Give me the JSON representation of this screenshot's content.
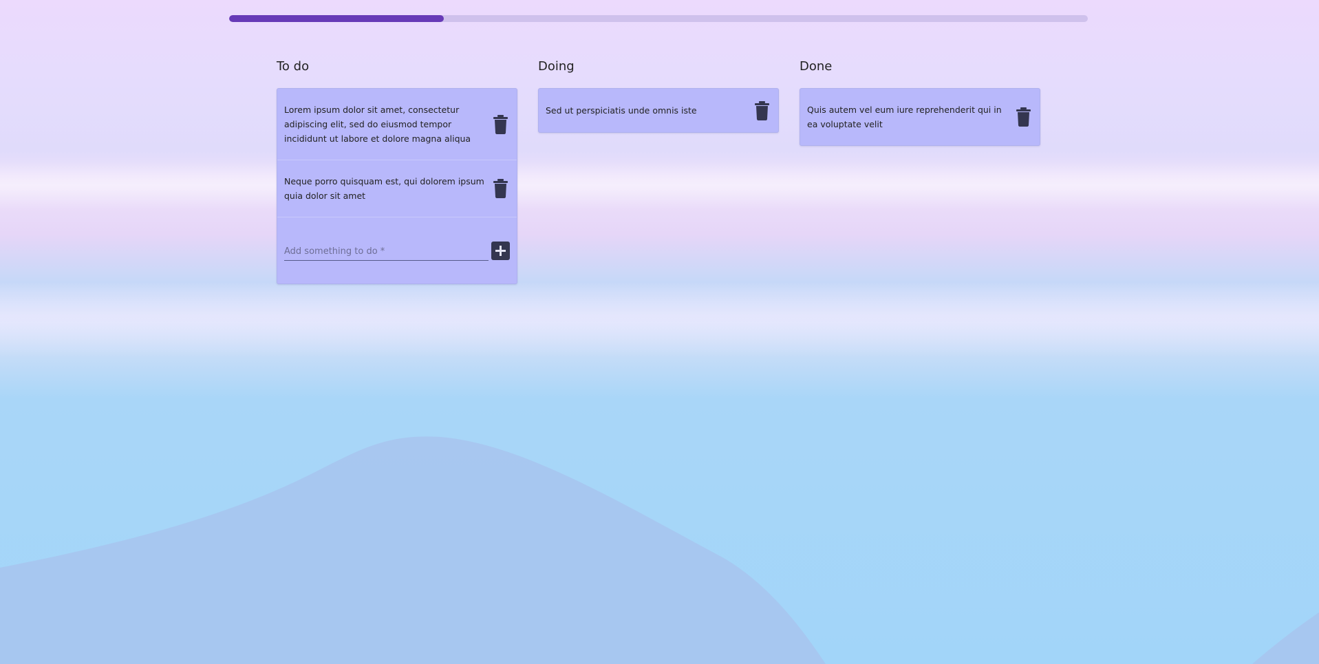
{
  "progress": {
    "value": 0.25
  },
  "columns": {
    "todo": {
      "title": "To do",
      "cards": [
        {
          "text": "Lorem ipsum dolor sit amet, consectetur adipiscing elit, sed do eiusmod tempor incididunt ut labore et dolore magna aliqua"
        },
        {
          "text": "Neque porro quisquam est, qui dolorem ipsum quia dolor sit amet"
        }
      ],
      "add_placeholder": "Add something to do *"
    },
    "doing": {
      "title": "Doing",
      "cards": [
        {
          "text": "Sed ut perspiciatis unde omnis iste"
        }
      ]
    },
    "done": {
      "title": "Done",
      "cards": [
        {
          "text": "Quis autem vel eum iure reprehenderit qui in ea voluptate velit"
        }
      ]
    }
  },
  "icons": {
    "delete": "trash-icon",
    "add": "plus-icon"
  },
  "colors": {
    "accent": "#673ab7",
    "card_bg": "#b8b8fb",
    "icon": "#343650"
  }
}
